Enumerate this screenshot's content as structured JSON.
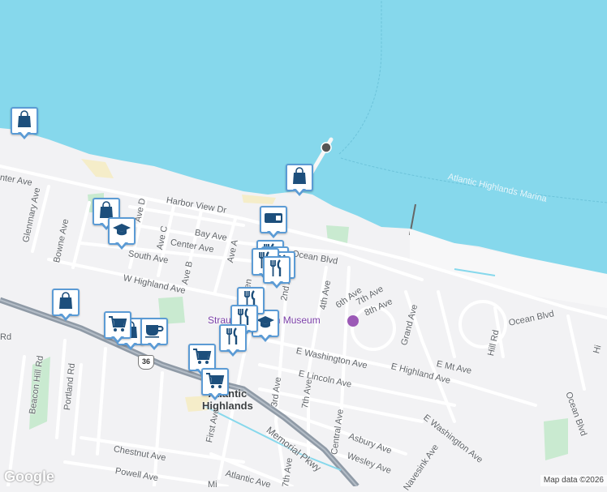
{
  "map": {
    "colors": {
      "water": "#86d8ec",
      "land": "#f2f2f4",
      "park": "#c9ead0",
      "beach": "#f5edc9",
      "highway": "#8f9aa6",
      "road": "#ffffff",
      "marker_border": "#5b9bd5",
      "marker_icon": "#1d4f7c",
      "poi_label": "#7b3fa8"
    },
    "water_labels": [
      {
        "text": "Atlantic Highlands Marina"
      }
    ],
    "street_labels": [
      {
        "text": "Harbor View Dr"
      },
      {
        "text": "Bay Ave"
      },
      {
        "text": "Center Ave"
      },
      {
        "text": "South Ave"
      },
      {
        "text": "W Highland Ave"
      },
      {
        "text": "Ocean Blvd"
      },
      {
        "text": "E Washington Ave"
      },
      {
        "text": "E Highland Ave"
      },
      {
        "text": "E Lincoln Ave"
      },
      {
        "text": "Asbury Ave"
      },
      {
        "text": "Wesley Ave"
      },
      {
        "text": "Chestnut Ave"
      },
      {
        "text": "Powell Ave"
      },
      {
        "text": "Atlantic Ave"
      },
      {
        "text": "Memorial Pkwy"
      },
      {
        "text": "First Ave"
      },
      {
        "text": "3rd Ave"
      },
      {
        "text": "7th Ave"
      },
      {
        "text": "Central Ave"
      },
      {
        "text": "Bowne Ave"
      },
      {
        "text": "Glenmary Ave"
      },
      {
        "text": "Beacon Hill Rd"
      },
      {
        "text": "Portland Rd"
      },
      {
        "text": "Ave A"
      },
      {
        "text": "Ave B"
      },
      {
        "text": "Ave C"
      },
      {
        "text": "Ave D"
      },
      {
        "text": "2nd Ave"
      },
      {
        "text": "4th Ave"
      },
      {
        "text": "6th Ave"
      },
      {
        "text": "7th Ave"
      },
      {
        "text": "8th Ave"
      },
      {
        "text": "Grand Ave"
      },
      {
        "text": "Ocean Blvd"
      },
      {
        "text": "Hill Rd"
      },
      {
        "text": "Ocean Blvd"
      },
      {
        "text": "E Mt Ave"
      },
      {
        "text": "E Washington Ave"
      },
      {
        "text": "Navesink Ave"
      },
      {
        "text": "Rd"
      },
      {
        "text": "Hi"
      },
      {
        "text": "nter Ave"
      },
      {
        "text": "7th Ave"
      },
      {
        "text": "Hen"
      },
      {
        "text": "Mi"
      }
    ],
    "poi": {
      "text": "Strauss Mansion Museum",
      "icon": "museum-icon"
    },
    "town": {
      "line1": "Atlantic",
      "line2": "Highlands"
    },
    "route_shield": "36",
    "markers": [
      {
        "icon": "shopping-bag-icon"
      },
      {
        "icon": "shopping-bag-icon"
      },
      {
        "icon": "shopping-bag-icon"
      },
      {
        "icon": "graduation-cap-icon"
      },
      {
        "icon": "cash-icon"
      },
      {
        "icon": "restaurant-icon"
      },
      {
        "icon": "restaurant-icon"
      },
      {
        "icon": "restaurant-icon"
      },
      {
        "icon": "restaurant-icon"
      },
      {
        "icon": "restaurant-icon"
      },
      {
        "icon": "graduation-cap-icon"
      },
      {
        "icon": "shopping-bag-icon"
      },
      {
        "icon": "shopping-cart-icon"
      },
      {
        "icon": "coffee-icon"
      },
      {
        "icon": "shopping-bag-icon"
      },
      {
        "icon": "restaurant-icon"
      },
      {
        "icon": "restaurant-icon"
      },
      {
        "icon": "restaurant-icon"
      },
      {
        "icon": "shopping-cart-icon"
      },
      {
        "icon": "shopping-cart-icon"
      }
    ],
    "attribution": {
      "logo": "Google",
      "copyright": "Map data ©2026"
    }
  }
}
